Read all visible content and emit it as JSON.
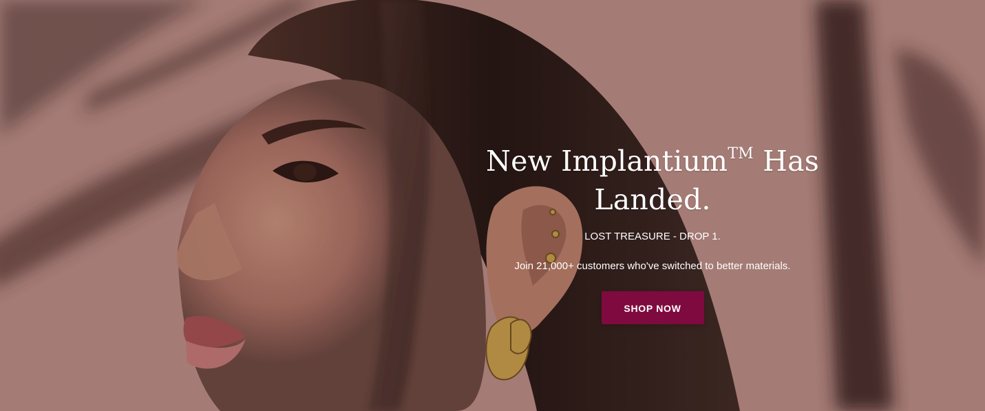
{
  "hero": {
    "title_main": "New Implantium",
    "title_mark": "TM",
    "title_end": " Has Landed.",
    "eyebrow": "LOST TREASURE - DROP 1.",
    "subtitle": "Join 21,000+ customers who've switched to better materials.",
    "button_label": "SHOP NOW",
    "button_color": "#7f0a3f",
    "background_description_icon": "portrait-photo-icon"
  }
}
